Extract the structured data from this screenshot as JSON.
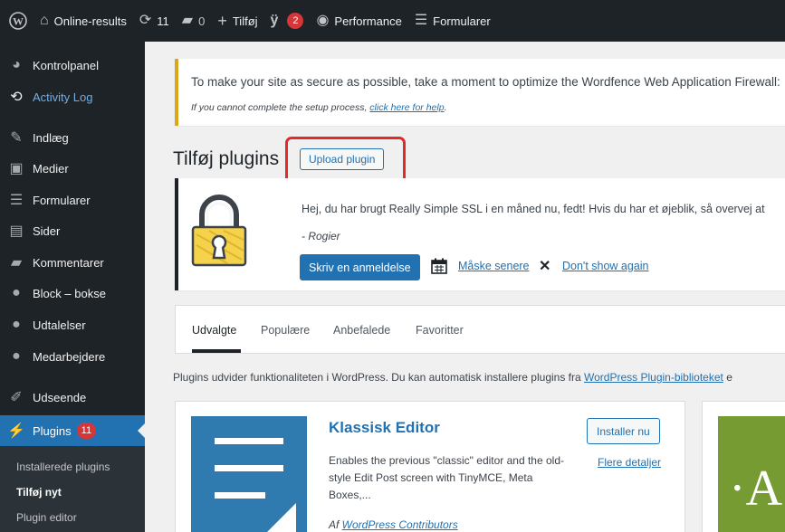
{
  "adminbar": {
    "site_name": "Online-results",
    "updates_count": "11",
    "comments_count": "0",
    "new_label": "Tilføj",
    "yoast_badge": "2",
    "performance_label": "Performance",
    "forms_label": "Formularer"
  },
  "sidebar": {
    "items": [
      {
        "label": "Kontrolpanel",
        "icon": "dashboard-icon"
      },
      {
        "label": "Activity Log",
        "icon": "history-icon"
      },
      {
        "label": "Indlæg",
        "icon": "pin-icon"
      },
      {
        "label": "Medier",
        "icon": "media-icon"
      },
      {
        "label": "Formularer",
        "icon": "forms-icon"
      },
      {
        "label": "Sider",
        "icon": "page-icon"
      },
      {
        "label": "Kommentarer",
        "icon": "comment-icon"
      },
      {
        "label": "Block – bokse",
        "icon": "user-icon"
      },
      {
        "label": "Udtalelser",
        "icon": "user-icon"
      },
      {
        "label": "Medarbejdere",
        "icon": "user-icon"
      },
      {
        "label": "Udseende",
        "icon": "brush-icon"
      },
      {
        "label": "Plugins",
        "icon": "plugin-icon",
        "badge": "11"
      }
    ],
    "submenu": [
      "Installerede plugins",
      "Tilføj nyt",
      "Plugin editor"
    ]
  },
  "wordfence_notice": {
    "text": "To make your site as secure as possible, take a moment to optimize the Wordfence Web Application Firewall:",
    "sub_prefix": "If you cannot complete the setup process, ",
    "sub_link": "click here for help",
    "sub_suffix": "."
  },
  "page": {
    "title": "Tilføj plugins",
    "upload_button": "Upload plugin"
  },
  "ssl_notice": {
    "text": "Hej, du har brugt Really Simple SSL i en måned nu, fedt! Hvis du har et øjeblik, så overvej at",
    "author": "- Rogier",
    "review_button": "Skriv en anmeldelse",
    "later_link": "Måske senere",
    "dismiss_x": "✕",
    "dont_show": "Don't show again"
  },
  "filter_tabs": [
    "Udvalgte",
    "Populære",
    "Anbefalede",
    "Favoritter"
  ],
  "description": {
    "text": "Plugins udvider funktionaliteten i WordPress. Du kan automatisk installere plugins fra ",
    "link": "WordPress Plugin-biblioteket",
    "suffix": " e"
  },
  "plugin_card": {
    "title": "Klassisk Editor",
    "description": "Enables the previous \"classic\" editor and the old-style Edit Post screen with TinyMCE, Meta Boxes,...",
    "author_prefix": "Af ",
    "author_link": "WordPress Contributors",
    "install_button": "Installer nu",
    "more_details": "Flere detaljer"
  },
  "plugin_card2": {
    "thumb_letter": "·A"
  },
  "colors": {
    "adminbar_bg": "#1d2327",
    "accent": "#2271b1",
    "badge": "#d63638",
    "highlight": "#e02b2b",
    "warning": "#dba617"
  }
}
